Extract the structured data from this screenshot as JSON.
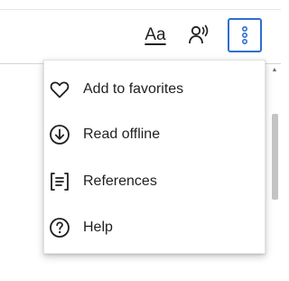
{
  "toolbar": {
    "text_size_label": "Aa",
    "text_size_icon": "text-size-icon",
    "read_aloud_icon": "read-aloud-icon",
    "more_icon": "more-options-icon",
    "accent_color": "#2e6fd1"
  },
  "menu": {
    "items": [
      {
        "label": "Add to favorites",
        "icon": "heart-icon"
      },
      {
        "label": "Read offline",
        "icon": "download-circle-icon"
      },
      {
        "label": "References",
        "icon": "references-icon"
      },
      {
        "label": "Help",
        "icon": "help-circle-icon"
      }
    ]
  }
}
